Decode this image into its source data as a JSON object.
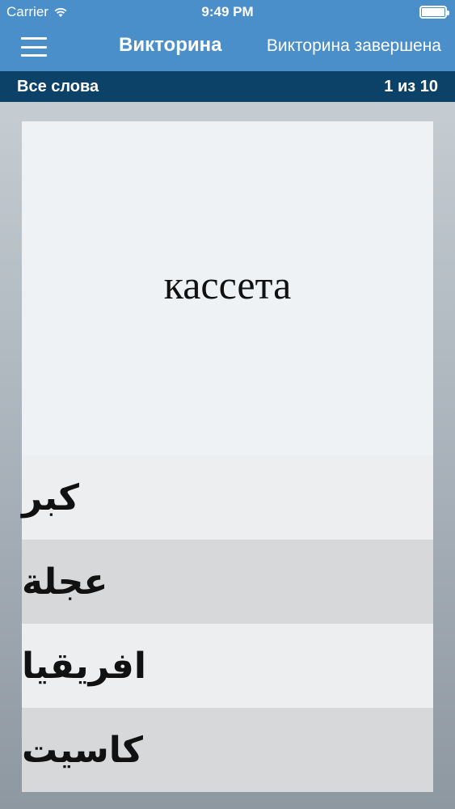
{
  "status_bar": {
    "carrier": "Carrier",
    "time": "9:49 PM"
  },
  "nav": {
    "title": "Викторина",
    "subtitle": "Викторина завершена"
  },
  "sub_bar": {
    "category": "Все слова",
    "progress": "1 из 10"
  },
  "question": {
    "word": "кассета"
  },
  "answers": [
    {
      "text": "كبر"
    },
    {
      "text": "عجلة"
    },
    {
      "text": "افريقيا"
    },
    {
      "text": "كاسيت"
    }
  ],
  "colors": {
    "nav_blue": "#4a8fc9",
    "sub_bar_navy": "#0d4268"
  }
}
